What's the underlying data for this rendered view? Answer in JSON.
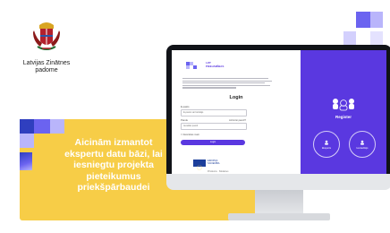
{
  "organization": {
    "name": "Latvijas Zinātnes\npadome"
  },
  "banner": {
    "text": "Aicinām izmantot ekspertu datu bāzi, lai iesniegtu projekta pieteikumus priekšpārbaudei"
  },
  "screen": {
    "brand": "LZP\nPIEEJAMĪBAS",
    "login_title": "Login",
    "email_label": "E-pasts",
    "email_placeholder": "E-pasts vai lietotājs",
    "password_label": "Parole",
    "forgot_label": "Aizmirsi paroli?",
    "password_placeholder": "Ievadiet paroli",
    "remember_label": "Atcerēties mani",
    "login_button": "Login",
    "eu_text": "EIROPAS\nSAVIENĪBA",
    "footer_links": "Privātums  ·  Sīkdatnes",
    "register_title": "Register",
    "option_1": "Eksperts",
    "option_2": "Iesniedzējs"
  },
  "colors": {
    "brand_yellow": "#f7cd47",
    "brand_purple": "#5a38e0",
    "square_purple": "#6b63f0",
    "square_lavender": "#b9b5fb"
  }
}
